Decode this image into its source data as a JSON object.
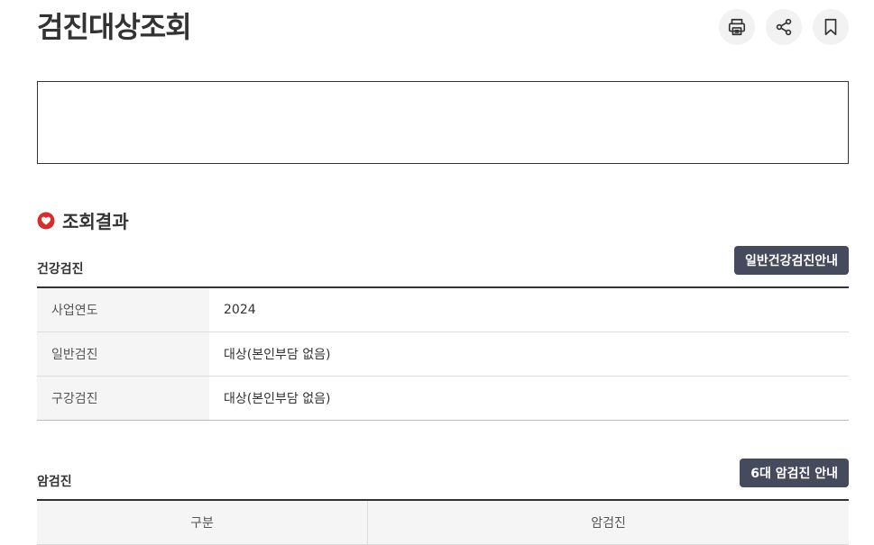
{
  "header": {
    "title": "검진대상조회",
    "actions": [
      {
        "name": "print-icon"
      },
      {
        "name": "share-icon"
      },
      {
        "name": "bookmark-icon"
      }
    ]
  },
  "result": {
    "section_title": "조회결과",
    "health": {
      "subtitle": "건강검진",
      "guide_button": "일반건강검진안내",
      "rows": [
        {
          "label": "사업연도",
          "value": "2024"
        },
        {
          "label": "일반검진",
          "value": "대상(본인부담 없음)"
        },
        {
          "label": "구강검진",
          "value": "대상(본인부담 없음)"
        }
      ]
    },
    "cancer": {
      "subtitle": "암검진",
      "guide_button": "6대 암검진 안내",
      "columns": [
        "구분",
        "암검진"
      ]
    }
  },
  "colors": {
    "accent": "#454a5c",
    "heart": "#d62d2d"
  }
}
